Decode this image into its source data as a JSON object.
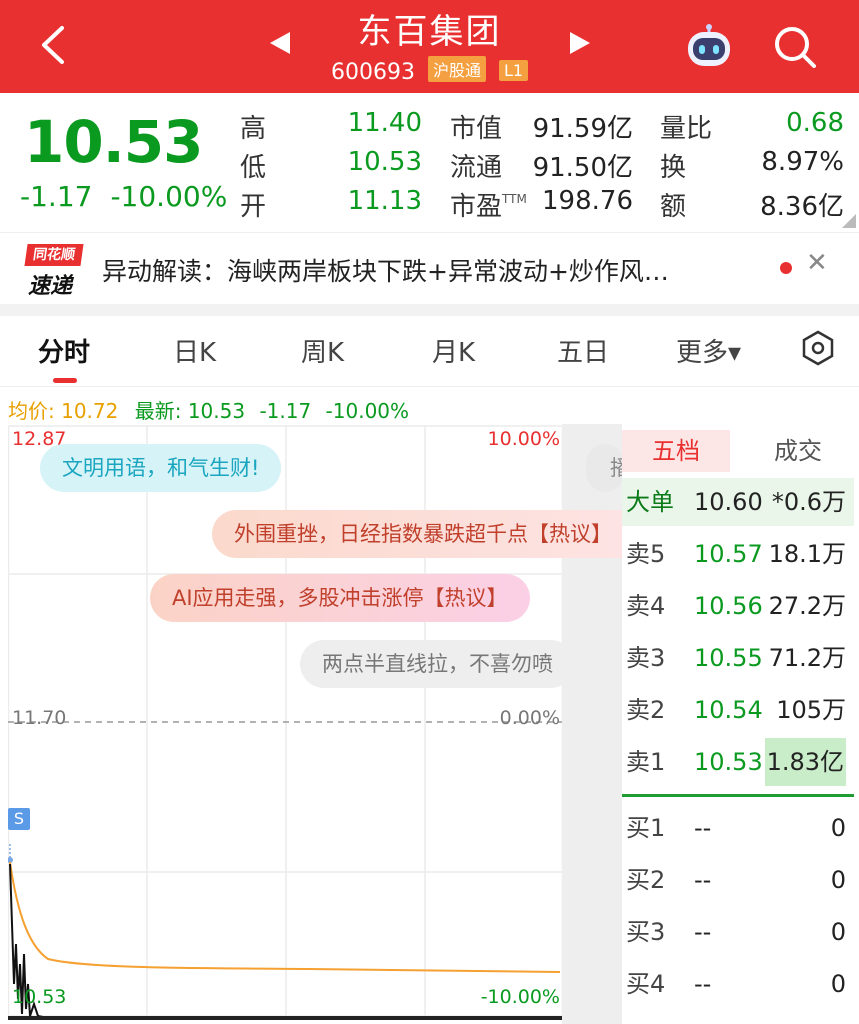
{
  "header": {
    "title": "东百集团",
    "code": "600693",
    "tag_exchange": "沪股通",
    "tag_level": "L1"
  },
  "quote": {
    "price": "10.53",
    "change": "-1.17",
    "change_pct": "-10.00%",
    "high_label": "高",
    "high": "11.40",
    "low_label": "低",
    "low": "10.53",
    "open_label": "开",
    "open": "11.13",
    "mktcap_label": "市值",
    "mktcap": "91.59亿",
    "float_label": "流通",
    "float": "91.50亿",
    "pe_label": "市盈",
    "pe_suffix": "TTM",
    "pe": "198.76",
    "vol_ratio_label": "量比",
    "vol_ratio": "0.68",
    "turnover_label": "换",
    "turnover": "8.97%",
    "amount_label": "额",
    "amount": "8.36亿"
  },
  "news": {
    "logo_top": "同花顺",
    "logo_bottom": "速递",
    "text": "异动解读：海峡两岸板块下跌+异常波动+炒作风…"
  },
  "tabs": [
    "分时",
    "日K",
    "周K",
    "月K",
    "五日",
    "更多▾"
  ],
  "info": {
    "avg": "均价: 10.72",
    "latest": "最新: 10.53",
    "change": "-1.17",
    "change_pct": "-10.00%"
  },
  "chart_labels": {
    "top_price": "12.87",
    "top_pct": "10.00%",
    "mid_price": "11.70",
    "mid_pct": "0.00%",
    "bottom_price": "10.53",
    "bottom_pct": "-10.00%",
    "marker": "S"
  },
  "bubbles": [
    "文明用语，和气生财!",
    "外围重挫，日经指数暴跌超千点【热议】",
    "AI应用走强，多股冲击涨停【热议】",
    "两点半直线拉，不喜勿喷",
    "播"
  ],
  "orderbook": {
    "tab_five": "五档",
    "tab_deal": "成交",
    "big": {
      "label": "大单",
      "price": "10.60",
      "vol": "*0.6万"
    },
    "sells": [
      {
        "label": "卖5",
        "price": "10.57",
        "vol": "18.1万"
      },
      {
        "label": "卖4",
        "price": "10.56",
        "vol": "27.2万"
      },
      {
        "label": "卖3",
        "price": "10.55",
        "vol": "71.2万"
      },
      {
        "label": "卖2",
        "price": "10.54",
        "vol": "105万"
      },
      {
        "label": "卖1",
        "price": "10.53",
        "vol": "1.83亿"
      }
    ],
    "buys": [
      {
        "label": "买1",
        "price": "--",
        "vol": "0"
      },
      {
        "label": "买2",
        "price": "--",
        "vol": "0"
      },
      {
        "label": "买3",
        "price": "--",
        "vol": "0"
      },
      {
        "label": "买4",
        "price": "--",
        "vol": "0"
      }
    ]
  },
  "colors": {
    "brand_red": "#e93030",
    "down_green": "#0b9a20",
    "avg_line": "#f5a030",
    "price_line": "#111111"
  }
}
